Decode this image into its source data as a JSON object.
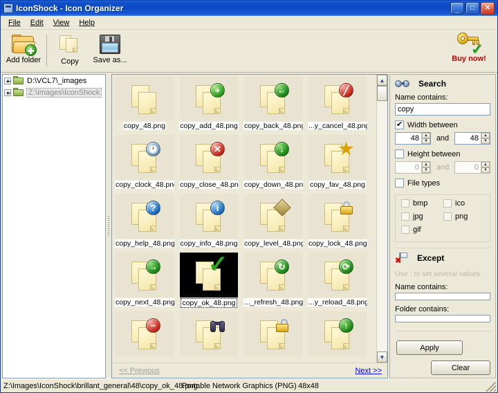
{
  "window": {
    "title": "IconShock - Icon Organizer",
    "icon": "app-icon",
    "minimize": "_",
    "maximize": "□",
    "close": "✕"
  },
  "menu": [
    {
      "label": "File"
    },
    {
      "label": "Edit"
    },
    {
      "label": "View"
    },
    {
      "label": "Help"
    }
  ],
  "toolbar": {
    "buttons": [
      {
        "label": "Add folder",
        "icon": "add-folder-icon"
      },
      {
        "label": "Copy",
        "icon": "copy-icon"
      },
      {
        "label": "Save as...",
        "icon": "save-as-icon"
      }
    ],
    "buy": {
      "label": "Buy now!",
      "icon": "key-check-icon"
    }
  },
  "tree": {
    "items": [
      {
        "label": "D:\\VCL7\\_images",
        "selected": false
      },
      {
        "label": "Z:\\Images\\IconShock",
        "selected": true
      }
    ]
  },
  "grid": {
    "items": [
      {
        "caption": "copy_48.png",
        "glyph": "none",
        "selected": false
      },
      {
        "caption": "copy_add_48.png",
        "glyph": "plus",
        "selected": false
      },
      {
        "caption": "copy_back_48.png",
        "glyph": "back",
        "selected": false
      },
      {
        "caption": "...y_cancel_48.png",
        "glyph": "cancel",
        "selected": false
      },
      {
        "caption": "copy_clock_48.png",
        "glyph": "clock",
        "selected": false
      },
      {
        "caption": "copy_close_48.png",
        "glyph": "close",
        "selected": false
      },
      {
        "caption": "copy_down_48.png",
        "glyph": "down",
        "selected": false
      },
      {
        "caption": "copy_fav_48.png",
        "glyph": "star",
        "selected": false
      },
      {
        "caption": "copy_help_48.png",
        "glyph": "help",
        "selected": false
      },
      {
        "caption": "copy_info_48.png",
        "glyph": "info",
        "selected": false
      },
      {
        "caption": "copy_level_48.png",
        "glyph": "level",
        "selected": false
      },
      {
        "caption": "copy_lock_48.png",
        "glyph": "lock",
        "selected": false
      },
      {
        "caption": "copy_next_48.png",
        "glyph": "next",
        "selected": false
      },
      {
        "caption": "copy_ok_48.png",
        "glyph": "ok",
        "selected": true
      },
      {
        "caption": "..._refresh_48.png",
        "glyph": "refresh",
        "selected": false
      },
      {
        "caption": "...y_reload_48.png",
        "glyph": "reload",
        "selected": false
      },
      {
        "caption": "",
        "glyph": "remove",
        "selected": false
      },
      {
        "caption": "",
        "glyph": "search",
        "selected": false
      },
      {
        "caption": "",
        "glyph": "unlock",
        "selected": false
      },
      {
        "caption": "",
        "glyph": "up",
        "selected": false
      }
    ]
  },
  "pager": {
    "previous": "<< Previous",
    "next": "Next >>"
  },
  "search": {
    "heading": "Search",
    "heading_icon": "goggles-icon",
    "name_label": "Name contains:",
    "name_value": "copy",
    "name_placeholder": "",
    "width_label": "Width between",
    "width_checked": true,
    "width_min": "48",
    "width_max": "48",
    "and_label": "and",
    "height_label": "Height between",
    "height_checked": false,
    "height_min": "0",
    "height_max": "0",
    "filetypes_label": "File types",
    "filetypes_checked": false,
    "filetypes": [
      {
        "label": "bmp",
        "checked": false
      },
      {
        "label": "ico",
        "checked": false
      },
      {
        "label": "jpg",
        "checked": false
      },
      {
        "label": "png",
        "checked": false
      },
      {
        "label": "gif",
        "checked": false
      }
    ]
  },
  "except": {
    "heading": "Except",
    "heading_icon": "flag-remove-icon",
    "hint": "Use ; to set several values",
    "name_label": "Name contains:",
    "name_value": "",
    "folder_label": "Folder contains:",
    "folder_value": ""
  },
  "actions": {
    "apply": "Apply",
    "clear": "Clear"
  },
  "status": {
    "path": "Z:\\Images\\IconShock\\brillant_general\\48\\copy_ok_48.png",
    "type": "Portable Network Graphics (PNG)",
    "size": "48x48"
  },
  "colors": {
    "titlebar": "#0b48c6",
    "accent_link": "#0000cc",
    "buy_text": "#c00000",
    "panel": "#ece9d8",
    "cell": "#e9e4d2"
  }
}
